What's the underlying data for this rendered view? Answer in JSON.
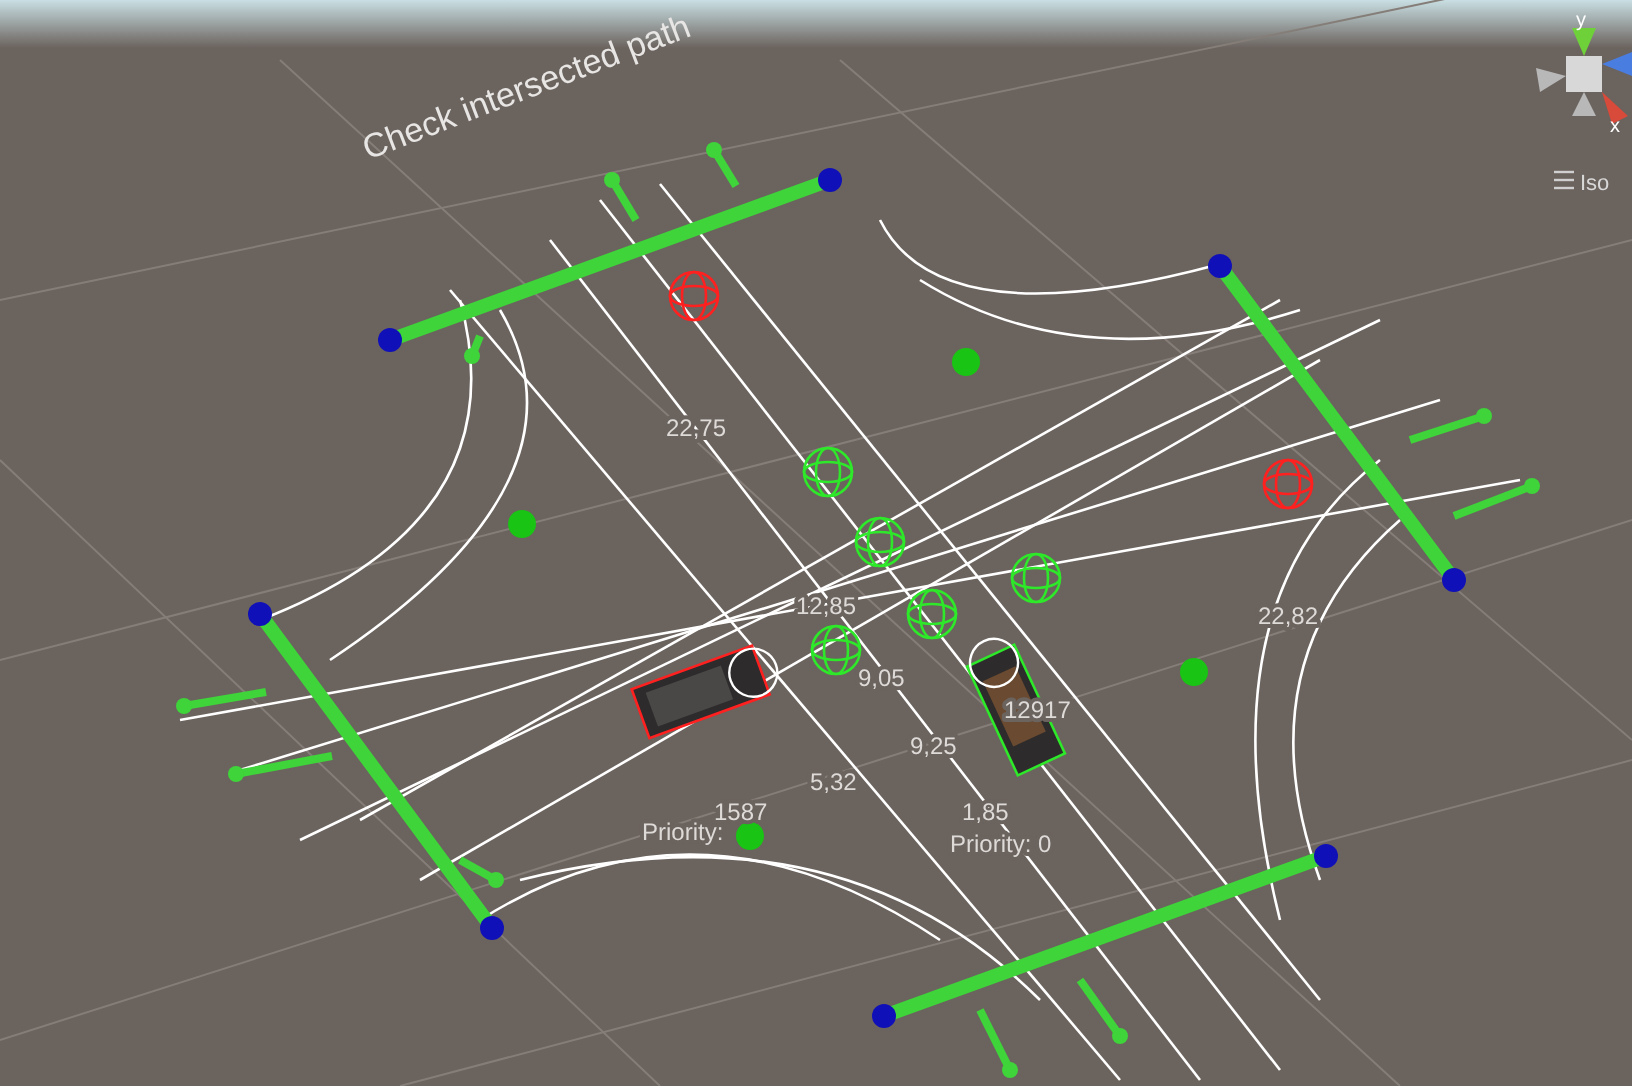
{
  "scene": {
    "title": "Check intersected path",
    "distance_labels": [
      "22,75",
      "12,85",
      "9,05",
      "9,25",
      "5,32",
      "22,82",
      "12917",
      "1587",
      "1,85"
    ],
    "priority_labels": [
      "Priority:",
      "Priority: 0"
    ]
  },
  "orientation_gizmo": {
    "y_label": "y",
    "x_label": "x",
    "view_mode": "Iso"
  }
}
